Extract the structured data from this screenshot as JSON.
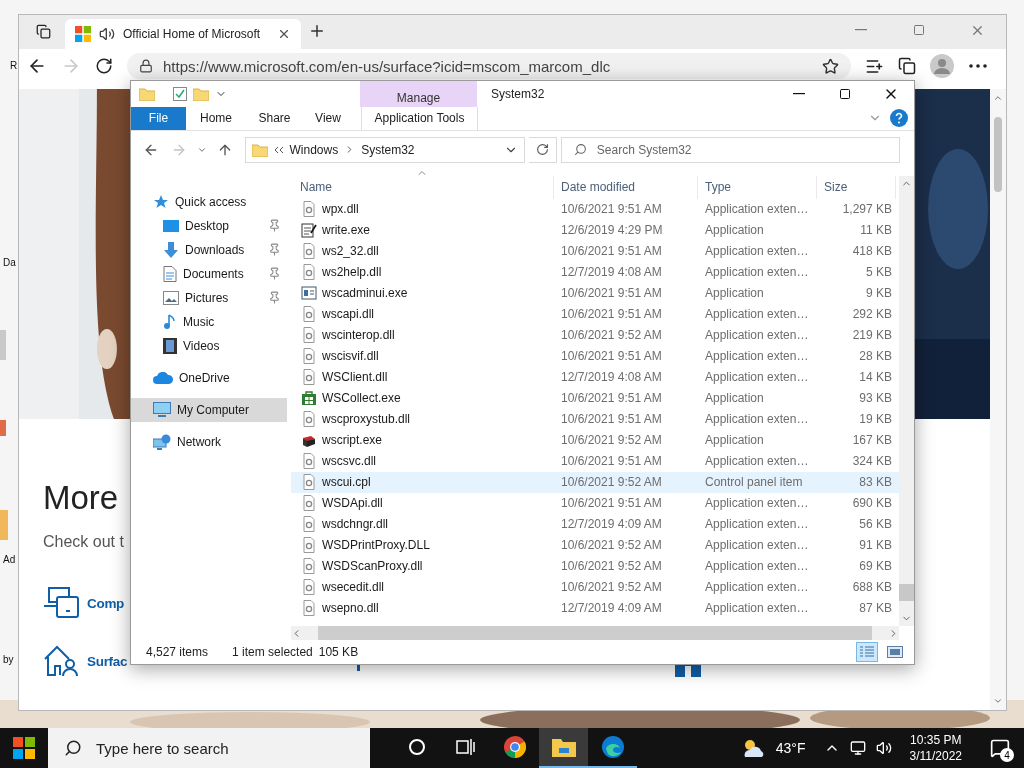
{
  "desktop": {
    "labels": [
      "R",
      "Da",
      "Ad",
      "by"
    ]
  },
  "browser": {
    "tabs": [
      {
        "title": "Official Home of Microsoft",
        "selected": true
      }
    ],
    "address": "https://www.microsoft.com/en-us/surface?icid=mscom_marcom_dlc",
    "page": {
      "heading": "More",
      "subheading": "Check out t",
      "links": [
        {
          "label": "Comp",
          "kind": "devices"
        },
        {
          "label": "Surfac",
          "kind": "people"
        }
      ]
    }
  },
  "explorer": {
    "title": "System32",
    "context_header": "Manage",
    "ribbon_tabs": [
      {
        "label": "File",
        "kind": "file"
      },
      {
        "label": "Home",
        "kind": "tab"
      },
      {
        "label": "Share",
        "kind": "tab"
      },
      {
        "label": "View",
        "kind": "tab"
      },
      {
        "label": "Application Tools",
        "kind": "context"
      }
    ],
    "breadcrumb": [
      "Windows",
      "System32"
    ],
    "search": {
      "placeholder": "Search System32"
    },
    "nav": [
      {
        "label": "Quick access",
        "kind": "star",
        "selected": false,
        "children": [
          {
            "label": "Desktop",
            "kind": "desktop",
            "pinned": true,
            "selected": false
          },
          {
            "label": "Downloads",
            "kind": "download",
            "pinned": true,
            "selected": false
          },
          {
            "label": "Documents",
            "kind": "document",
            "pinned": true,
            "selected": false
          },
          {
            "label": "Pictures",
            "kind": "pictures",
            "pinned": true,
            "selected": false
          },
          {
            "label": "Music",
            "kind": "music",
            "pinned": false,
            "selected": false
          },
          {
            "label": "Videos",
            "kind": "videos",
            "pinned": false,
            "selected": false
          }
        ]
      },
      {
        "label": "OneDrive",
        "kind": "cloud",
        "selected": false
      },
      {
        "label": "My Computer",
        "kind": "computer",
        "selected": true
      },
      {
        "label": "Network",
        "kind": "network",
        "selected": false
      }
    ],
    "columns": [
      "Name",
      "Date modified",
      "Type",
      "Size"
    ],
    "rows": [
      {
        "name": "wpx.dll",
        "date": "10/6/2021 9:51 AM",
        "type": "Application exten…",
        "size": "1,297 KB",
        "kind": "dll",
        "selected": false
      },
      {
        "name": "write.exe",
        "date": "12/6/2019 4:29 PM",
        "type": "Application",
        "size": "11 KB",
        "kind": "write",
        "selected": false
      },
      {
        "name": "ws2_32.dll",
        "date": "10/6/2021 9:51 AM",
        "type": "Application exten…",
        "size": "418 KB",
        "kind": "dll",
        "selected": false
      },
      {
        "name": "ws2help.dll",
        "date": "12/7/2019 4:08 AM",
        "type": "Application exten…",
        "size": "5 KB",
        "kind": "dll",
        "selected": false
      },
      {
        "name": "wscadminui.exe",
        "date": "10/6/2021 9:51 AM",
        "type": "Application",
        "size": "9 KB",
        "kind": "window",
        "selected": false
      },
      {
        "name": "wscapi.dll",
        "date": "10/6/2021 9:51 AM",
        "type": "Application exten…",
        "size": "292 KB",
        "kind": "dll",
        "selected": false
      },
      {
        "name": "wscinterop.dll",
        "date": "10/6/2021 9:52 AM",
        "type": "Application exten…",
        "size": "219 KB",
        "kind": "dll",
        "selected": false
      },
      {
        "name": "wscisvif.dll",
        "date": "10/6/2021 9:51 AM",
        "type": "Application exten…",
        "size": "28 KB",
        "kind": "dll",
        "selected": false
      },
      {
        "name": "WSClient.dll",
        "date": "12/7/2019 4:08 AM",
        "type": "Application exten…",
        "size": "14 KB",
        "kind": "dll",
        "selected": false
      },
      {
        "name": "WSCollect.exe",
        "date": "10/6/2021 9:51 AM",
        "type": "Application",
        "size": "93 KB",
        "kind": "store",
        "selected": false
      },
      {
        "name": "wscproxystub.dll",
        "date": "10/6/2021 9:51 AM",
        "type": "Application exten…",
        "size": "19 KB",
        "kind": "dll",
        "selected": false
      },
      {
        "name": "wscript.exe",
        "date": "10/6/2021 9:52 AM",
        "type": "Application",
        "size": "167 KB",
        "kind": "script",
        "selected": false
      },
      {
        "name": "wscsvc.dll",
        "date": "10/6/2021 9:51 AM",
        "type": "Application exten…",
        "size": "324 KB",
        "kind": "dll",
        "selected": false
      },
      {
        "name": "wscui.cpl",
        "date": "10/6/2021 9:52 AM",
        "type": "Control panel item",
        "size": "83 KB",
        "kind": "dll",
        "selected": true
      },
      {
        "name": "WSDApi.dll",
        "date": "10/6/2021 9:51 AM",
        "type": "Application exten…",
        "size": "690 KB",
        "kind": "dll",
        "selected": false
      },
      {
        "name": "wsdchngr.dll",
        "date": "12/7/2019 4:09 AM",
        "type": "Application exten…",
        "size": "56 KB",
        "kind": "dll",
        "selected": false
      },
      {
        "name": "WSDPrintProxy.DLL",
        "date": "10/6/2021 9:52 AM",
        "type": "Application exten…",
        "size": "91 KB",
        "kind": "dll",
        "selected": false
      },
      {
        "name": "WSDScanProxy.dll",
        "date": "10/6/2021 9:52 AM",
        "type": "Application exten…",
        "size": "69 KB",
        "kind": "dll",
        "selected": false
      },
      {
        "name": "wsecedit.dll",
        "date": "10/6/2021 9:52 AM",
        "type": "Application exten…",
        "size": "688 KB",
        "kind": "dll",
        "selected": false
      },
      {
        "name": "wsepno.dll",
        "date": "12/7/2019 4:09 AM",
        "type": "Application exten…",
        "size": "87 KB",
        "kind": "dll",
        "selected": false
      }
    ],
    "status": {
      "count": "4,527 items",
      "selection": "1 item selected",
      "size": "105 KB"
    },
    "views": [
      {
        "kind": "details",
        "selected": true
      },
      {
        "kind": "thumbnails",
        "selected": false
      }
    ]
  },
  "taskbar": {
    "search": {
      "placeholder": "Type here to search"
    },
    "apps": [
      {
        "kind": "cortana",
        "selected": false,
        "running": false
      },
      {
        "kind": "taskview",
        "selected": false,
        "running": false
      },
      {
        "kind": "chrome",
        "selected": false,
        "running": false
      },
      {
        "kind": "files",
        "selected": true,
        "running": true
      },
      {
        "kind": "edge",
        "selected": false,
        "running": true
      }
    ],
    "weather": "43°F",
    "time": "10:35 PM",
    "date": "3/11/2022",
    "notifications": "4"
  }
}
